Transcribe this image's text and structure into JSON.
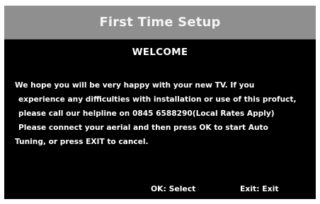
{
  "colors": {
    "title_bar_bg": "#8f8f8f",
    "screen_bg": "#000000",
    "text": "#ffffff"
  },
  "dialog": {
    "title": "First Time Setup",
    "heading": "WELCOME",
    "body_lines": [
      "We hope you will be very happy with your new TV. If you",
      "experience any difficulties with installation or use of this profuct,",
      "please call our helpline on 0845 6588290(Local Rates Apply)",
      "Please connect your aerial and then press OK to start Auto",
      "Tuning, or  press EXIT to cancel."
    ]
  },
  "footer": {
    "select_hint": "OK: Select",
    "exit_hint": "Exit: Exit"
  }
}
